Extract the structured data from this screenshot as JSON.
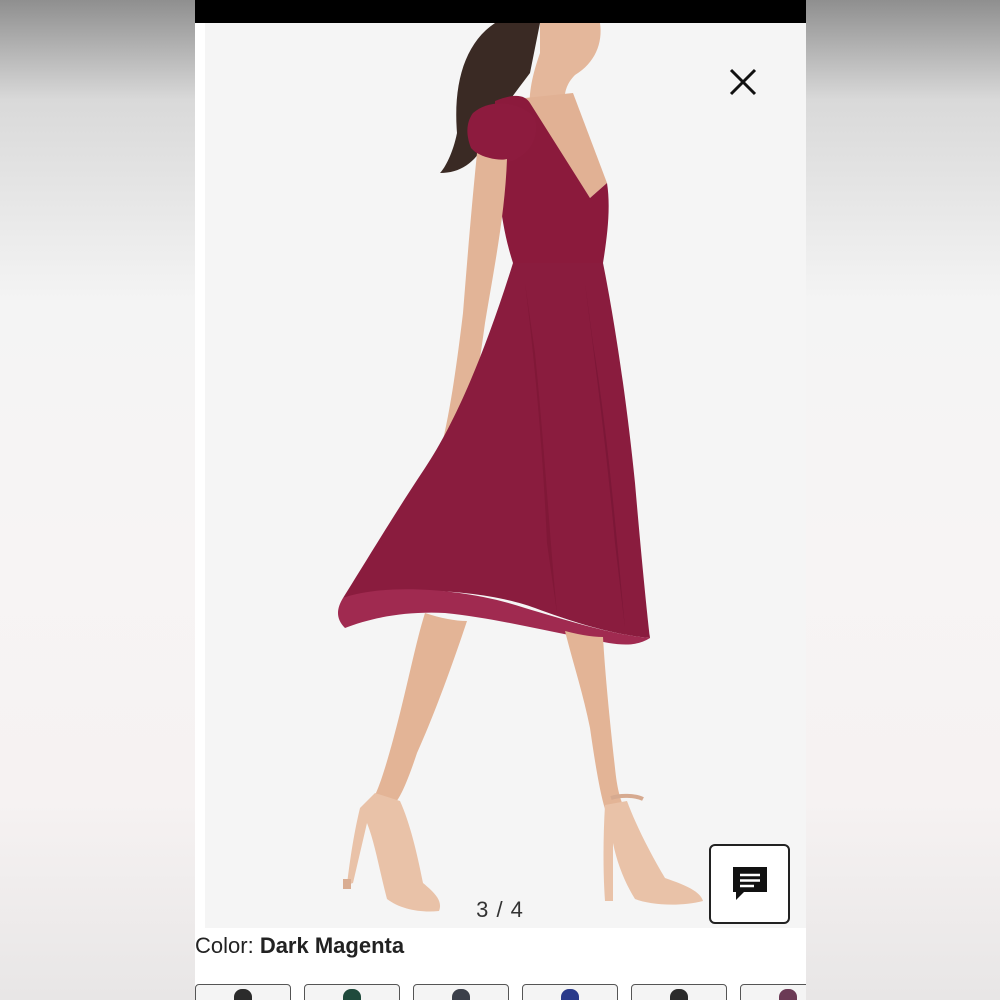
{
  "viewer": {
    "image_counter": "3 / 4",
    "image_alt": "Model wearing dark magenta cap-sleeve midi dress with ruffled hem and nude heels"
  },
  "product": {
    "color_label": "Color:",
    "color_value": "Dark Magenta"
  },
  "swatches": [
    {
      "name": "swatch-1",
      "color": "#2b2b2b"
    },
    {
      "name": "swatch-2",
      "color": "#1f4a3c"
    },
    {
      "name": "swatch-3",
      "color": "#3b3f4a"
    },
    {
      "name": "swatch-4",
      "color": "#2a3a8a"
    },
    {
      "name": "swatch-5",
      "color": "#2b2b2b"
    },
    {
      "name": "swatch-6",
      "color": "#6b3a55"
    }
  ],
  "colors": {
    "dress": "#8c1d3f",
    "background": "#f5f5f5",
    "status_bar": "#000000"
  }
}
